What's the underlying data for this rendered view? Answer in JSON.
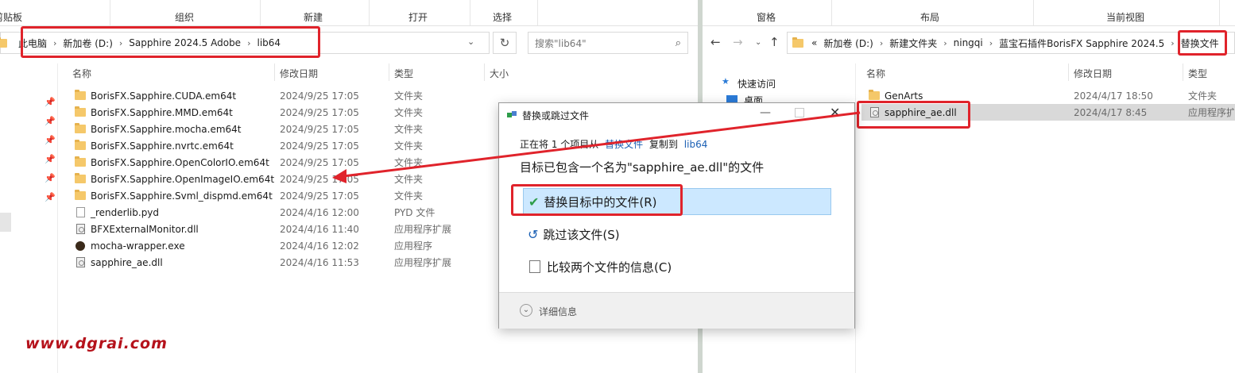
{
  "left": {
    "ribbon": {
      "clip_text": "剪贴板",
      "organize": "组织",
      "new": "新建",
      "open": "打开",
      "select": "选择"
    },
    "breadcrumb": [
      "此电脑",
      "新加卷 (D:)",
      "Sapphire 2024.5 Adobe",
      "lib64"
    ],
    "search_placeholder": "搜索\"lib64\"",
    "columns": {
      "name": "名称",
      "modified": "修改日期",
      "type": "类型",
      "size": "大小"
    },
    "files": [
      {
        "name": "BorisFX.Sapphire.CUDA.em64t",
        "date": "2024/9/25 17:05",
        "type": "文件夹",
        "icon": "folder"
      },
      {
        "name": "BorisFX.Sapphire.MMD.em64t",
        "date": "2024/9/25 17:05",
        "type": "文件夹",
        "icon": "folder"
      },
      {
        "name": "BorisFX.Sapphire.mocha.em64t",
        "date": "2024/9/25 17:05",
        "type": "文件夹",
        "icon": "folder"
      },
      {
        "name": "BorisFX.Sapphire.nvrtc.em64t",
        "date": "2024/9/25 17:05",
        "type": "文件夹",
        "icon": "folder"
      },
      {
        "name": "BorisFX.Sapphire.OpenColorIO.em64t",
        "date": "2024/9/25 17:05",
        "type": "文件夹",
        "icon": "folder"
      },
      {
        "name": "BorisFX.Sapphire.OpenImageIO.em64t",
        "date": "2024/9/25 17:05",
        "type": "文件夹",
        "icon": "folder"
      },
      {
        "name": "BorisFX.Sapphire.Svml_dispmd.em64t",
        "date": "2024/9/25 17:05",
        "type": "文件夹",
        "icon": "folder"
      },
      {
        "name": "_renderlib.pyd",
        "date": "2024/4/16 12:00",
        "type": "PYD 文件",
        "icon": "file"
      },
      {
        "name": "BFXExternalMonitor.dll",
        "date": "2024/4/16 11:40",
        "type": "应用程序扩展",
        "icon": "dll"
      },
      {
        "name": "mocha-wrapper.exe",
        "date": "2024/4/16 12:02",
        "type": "应用程序",
        "icon": "exe"
      },
      {
        "name": "sapphire_ae.dll",
        "date": "2024/4/16 11:53",
        "type": "应用程序扩展",
        "icon": "dll"
      }
    ]
  },
  "right": {
    "ribbon": {
      "pane": "窗格",
      "layout": "布局",
      "current_view": "当前视图"
    },
    "breadcrumb": [
      "«",
      "新加卷 (D:)",
      "新建文件夹",
      "ningqi",
      "蓝宝石插件BorisFX Sapphire 2024.5",
      "替换文件"
    ],
    "columns": {
      "name": "名称",
      "modified": "修改日期",
      "type": "类型"
    },
    "nav": {
      "quick_access": "快速访问",
      "desktop": "桌面"
    },
    "files": [
      {
        "name": "GenArts",
        "date": "2024/4/17 18:50",
        "type": "文件夹",
        "icon": "folder"
      },
      {
        "name": "sapphire_ae.dll",
        "date": "2024/4/17 8:45",
        "type": "应用程序扩",
        "icon": "dll"
      }
    ]
  },
  "dialog": {
    "title": "替换或跳过文件",
    "line1_prefix": "正在将 1 个项目从",
    "line1_from": "替换文件",
    "line1_mid": "复制到",
    "line1_to": "lib64",
    "heading": "目标已包含一个名为\"sapphire_ae.dll\"的文件",
    "opt_replace": "替换目标中的文件(R)",
    "opt_skip": "跳过该文件(S)",
    "opt_compare": "比较两个文件的信息(C)",
    "details": "详细信息"
  },
  "watermark": "www.dgrai.com",
  "colors": {
    "highlight_red": "#e0232b",
    "select_blue": "#cce8ff",
    "link_blue": "#1a5fb4",
    "watermark": "#b5121b"
  }
}
